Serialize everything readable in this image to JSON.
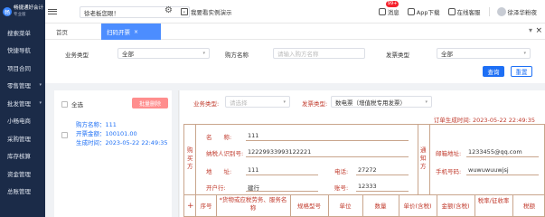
{
  "brand": {
    "logo_char": "畅",
    "name": "畅捷通好会计",
    "edition": "专业版"
  },
  "sidebar": {
    "items": [
      {
        "label": "搜索菜单",
        "caret": ""
      },
      {
        "label": "快捷导航",
        "caret": ""
      },
      {
        "label": "项目合同",
        "caret": ""
      },
      {
        "label": "零售管理",
        "caret": "▾"
      },
      {
        "label": "批发管理",
        "caret": "▾"
      },
      {
        "label": "小畅电商",
        "caret": ""
      },
      {
        "label": "采购管理",
        "caret": ""
      },
      {
        "label": "库存核算",
        "caret": ""
      },
      {
        "label": "资金管理",
        "caret": ""
      },
      {
        "label": "总账管理",
        "caret": ""
      }
    ]
  },
  "topbar": {
    "shop": "徐老板您眼！",
    "demo": "我要看实例演示",
    "msg_label": "消息",
    "msg_badge": "99+",
    "app": "App下载",
    "service": "在线客服",
    "user": "徐泽华粉夜"
  },
  "tabs": {
    "home": "首页",
    "active": "扫码开票",
    "close": "×",
    "arrow": "▾",
    "panel_close": "×"
  },
  "filters": {
    "biz_type_label": "业务类型",
    "biz_type_value": "全部",
    "buyer_label": "购方名称",
    "buyer_placeholder": "请输入购方名称",
    "invoice_type_label": "发票类型",
    "invoice_type_value": "全部",
    "query": "查询",
    "reset": "重置"
  },
  "list": {
    "select_all": "全选",
    "batch_delete": "批量删除",
    "item": {
      "buyer": "购方名称：111",
      "amount": "开票金额：100101.00",
      "time": "生成时间：2023-05-22 22:49:35"
    }
  },
  "invoice": {
    "biz_type_label": "业务类型:",
    "biz_type_placeholder": "请选择",
    "invoice_type_label": "发票类型:",
    "invoice_type_value": "数电票（增值税专用发票）",
    "order_time": "订单生成时间:  2023-05-22 22:49:35",
    "buyer_side": "购买方",
    "notify_side": "通知方",
    "name_label": "名　　称:",
    "name_value": "111",
    "tax_label": "纳税人识别号:",
    "tax_value": "12229933993122221",
    "addr_label": "地　　址:",
    "addr_value": "111",
    "phone_label": "电话:",
    "phone_value": "27272",
    "bank_label": "开户行:",
    "bank_value": "建行",
    "account_label": "账号:",
    "account_value": "12333",
    "email_label": "邮箱地址:",
    "email_value": "1233455@qq.com",
    "mobile_label": "手机号码:",
    "mobile_value": "wuwuwuuwjsj",
    "columns": [
      "序号",
      "*项目名称",
      "规格型号",
      "单位",
      "数量",
      "单价(含税)",
      "金额(含税)",
      "税率/征收率",
      "税额"
    ],
    "col_goods": "*货物或应税劳务、服务名称",
    "plus": "+"
  }
}
